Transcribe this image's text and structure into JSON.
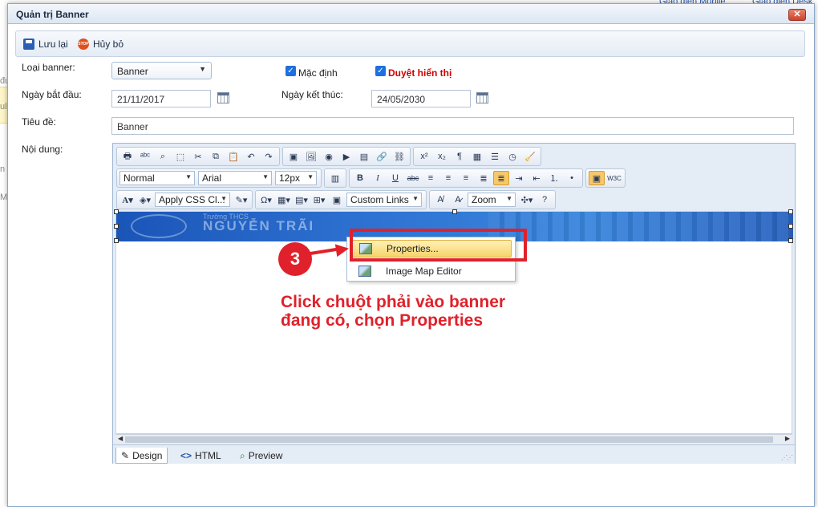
{
  "background": {
    "links": [
      "Giao diện Mobile",
      "Giao diện Desk"
    ],
    "side_fragments": [
      "đư",
      "ule",
      "n p",
      "Mo"
    ]
  },
  "dialog": {
    "title": "Quản trị Banner",
    "close_label": "✕",
    "actions": {
      "save": "Lưu lại",
      "cancel": "Hủy bỏ"
    }
  },
  "form": {
    "type_label": "Loại banner:",
    "type_value": "Banner",
    "default_label": "Mặc định",
    "approve_label": "Duyệt hiển thị",
    "start_label": "Ngày bắt đầu:",
    "start_value": "21/11/2017",
    "end_label": "Ngày kết thúc:",
    "end_value": "24/05/2030",
    "title_label": "Tiêu đề:",
    "title_value": "Banner",
    "content_label": "Nội dung:"
  },
  "toolbar": {
    "format": "Normal",
    "font": "Arial",
    "size": "12px",
    "css_class": "Apply CSS Cl...",
    "links": "Custom Links",
    "zoom": "Zoom"
  },
  "banner": {
    "small_text": "Trường THCS",
    "big_text": "NGUYỄN TRÃI"
  },
  "context_menu": {
    "items": [
      "Properties...",
      "Image Map Editor"
    ]
  },
  "modes": [
    "Design",
    "HTML",
    "Preview"
  ],
  "annotation": {
    "step": "3",
    "line1": "Click chuột phải vào banner",
    "line2": "đang có, chọn Properties"
  },
  "colors": {
    "accent": "#e0212b",
    "editor_bg": "#e4ecf6",
    "banner": "#2f74d3"
  }
}
